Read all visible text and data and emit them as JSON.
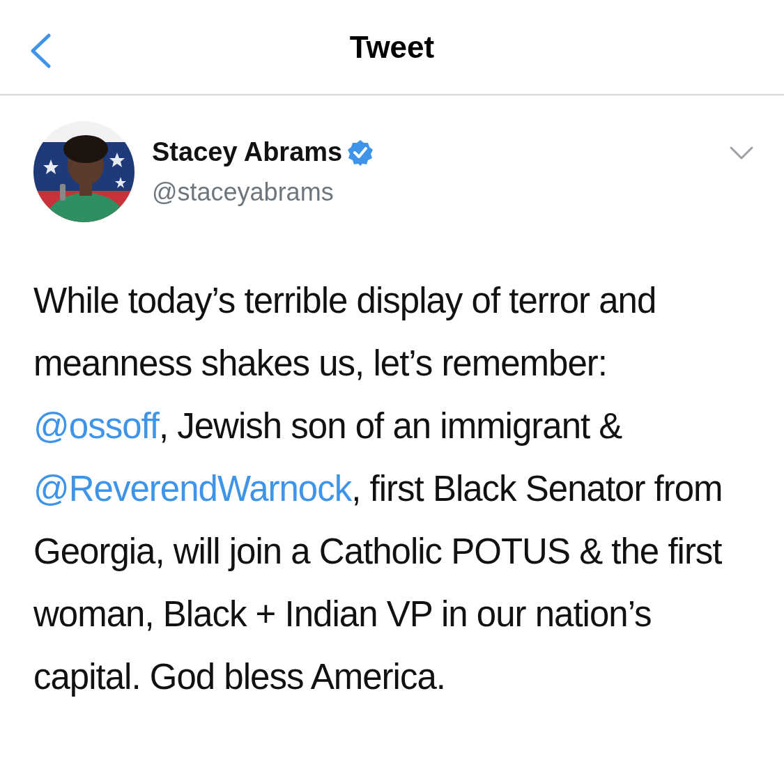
{
  "header": {
    "title": "Tweet"
  },
  "tweet": {
    "author": {
      "name": "Stacey Abrams",
      "handle": "@staceyabrams",
      "verified": true
    },
    "text": [
      {
        "kind": "text",
        "text": "While today’s terrible display of terror and meanness shakes us, let’s remember: "
      },
      {
        "kind": "mention",
        "text": "@ossoff"
      },
      {
        "kind": "text",
        "text": ", Jewish son of an immigrant & "
      },
      {
        "kind": "mention",
        "text": "@ReverendWarnock"
      },
      {
        "kind": "text",
        "text": ", first Black Senator from Georgia, will join a Catholic POTUS & the first woman, Black + Indian VP in our nation’s capital. God bless America."
      }
    ]
  }
}
